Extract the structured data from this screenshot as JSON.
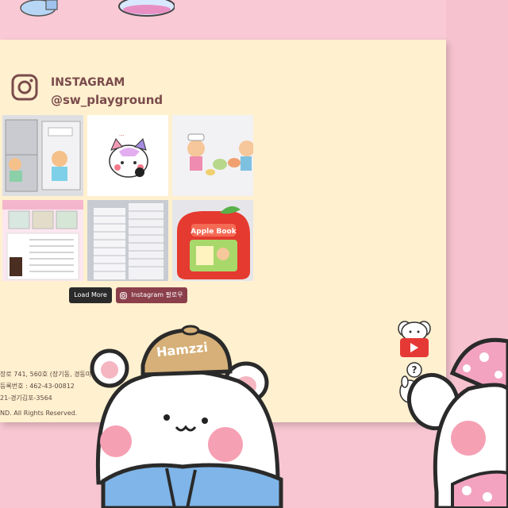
{
  "instagram": {
    "title": "INSTAGRAM",
    "handle": "@sw_playground",
    "load_more": "Load More",
    "follow_label": "Instagram 팔로우",
    "posts": [
      {
        "kind": "fridge-cat"
      },
      {
        "kind": "cat-sticker"
      },
      {
        "kind": "sticker-sheet"
      },
      {
        "kind": "sticker-list"
      },
      {
        "kind": "paper-stack"
      },
      {
        "kind": "apple-book",
        "text": "Apple Book"
      }
    ]
  },
  "footer": {
    "address": "장로 741, 560호 (장기동, 경동미르웰시티)",
    "business_reg": "등록번호 : 462-43-00812",
    "mail_order": "21-경기김포-3564",
    "copyright": "ND. All Rights Reserved."
  },
  "character": {
    "hat_text": "Hamzzi"
  },
  "colors": {
    "page_bg": "#f7c6d2",
    "panel_bg": "#fff0cf",
    "accent_text": "#7a4b4b",
    "follow_button": "#8b3f4b",
    "youtube_red": "#e53935"
  }
}
